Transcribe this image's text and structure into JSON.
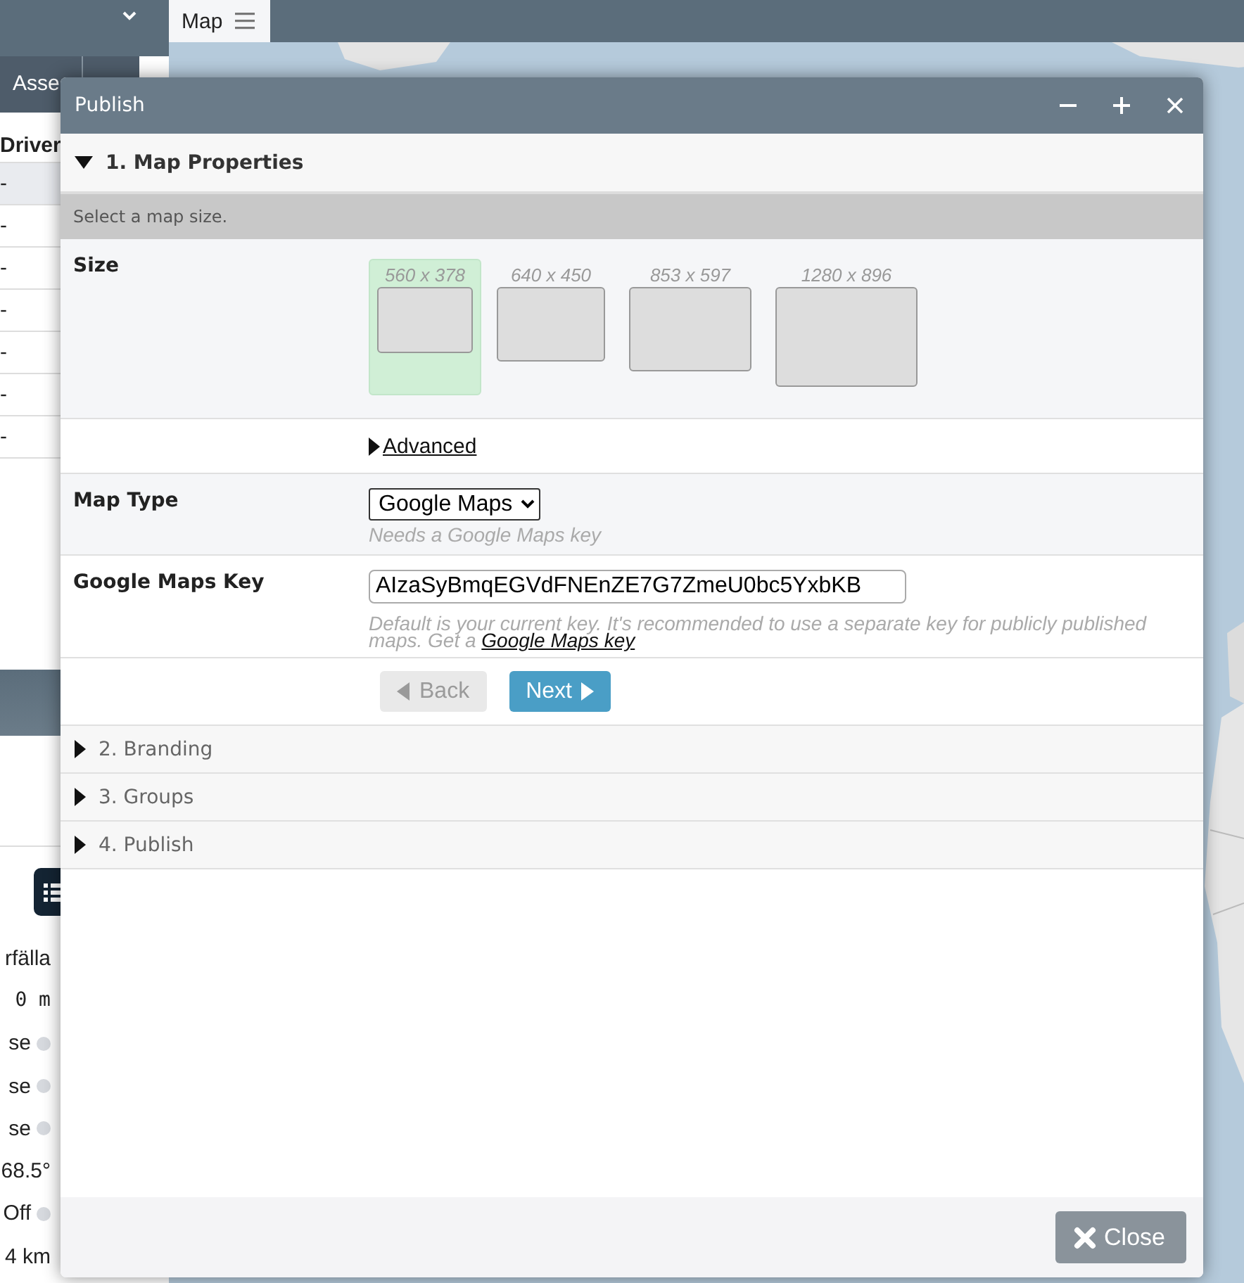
{
  "left_panel": {
    "tab": "Asse",
    "column_header": "Driver",
    "rows": [
      {
        "value": "-",
        "selected": true
      },
      {
        "value": "-",
        "selected": false
      },
      {
        "value": "-",
        "selected": false
      },
      {
        "value": "-",
        "selected": false
      },
      {
        "value": "-",
        "selected": false
      },
      {
        "value": "-",
        "selected": false
      },
      {
        "value": "-",
        "selected": false
      }
    ],
    "details": [
      {
        "value": "rfälla",
        "indicator": false
      },
      {
        "value": "0 m",
        "indicator": false
      },
      {
        "value": "se",
        "indicator": true
      },
      {
        "value": "se",
        "indicator": true
      },
      {
        "value": "se",
        "indicator": true
      },
      {
        "value": "68.5°",
        "indicator": false
      },
      {
        "value": "Off",
        "indicator": true
      },
      {
        "value": "4 km",
        "indicator": false
      }
    ]
  },
  "map_tab": {
    "label": "Map"
  },
  "dialog": {
    "title": "Publish",
    "sections": [
      {
        "title": "1. Map Properties",
        "expanded": true
      },
      {
        "title": "2. Branding",
        "expanded": false
      },
      {
        "title": "3. Groups",
        "expanded": false
      },
      {
        "title": "4. Publish",
        "expanded": false
      }
    ],
    "map_properties": {
      "instruction": "Select a map size.",
      "size": {
        "label": "Size",
        "options": [
          {
            "label": "560 x 378",
            "selected": true
          },
          {
            "label": "640 x 450",
            "selected": false
          },
          {
            "label": "853 x 597",
            "selected": false
          },
          {
            "label": "1280 x 896",
            "selected": false
          }
        ]
      },
      "advanced": {
        "label": "Advanced",
        "expanded": false
      },
      "map_type": {
        "label": "Map Type",
        "value": "Google Maps",
        "hint": "Needs a Google Maps key"
      },
      "maps_key": {
        "label": "Google Maps Key",
        "value": "AIzaSyBmqEGVdFNEnZE7G7ZmeU0bc5YxbKB",
        "hint": "Default is your current key. It's recommended to use a separate key for publicly published maps. Get a ",
        "hint_link": "Google Maps key"
      },
      "back_button": {
        "label": "Back",
        "disabled": true
      },
      "next_button": {
        "label": "Next",
        "disabled": false
      }
    },
    "close_button": {
      "label": "Close"
    }
  }
}
